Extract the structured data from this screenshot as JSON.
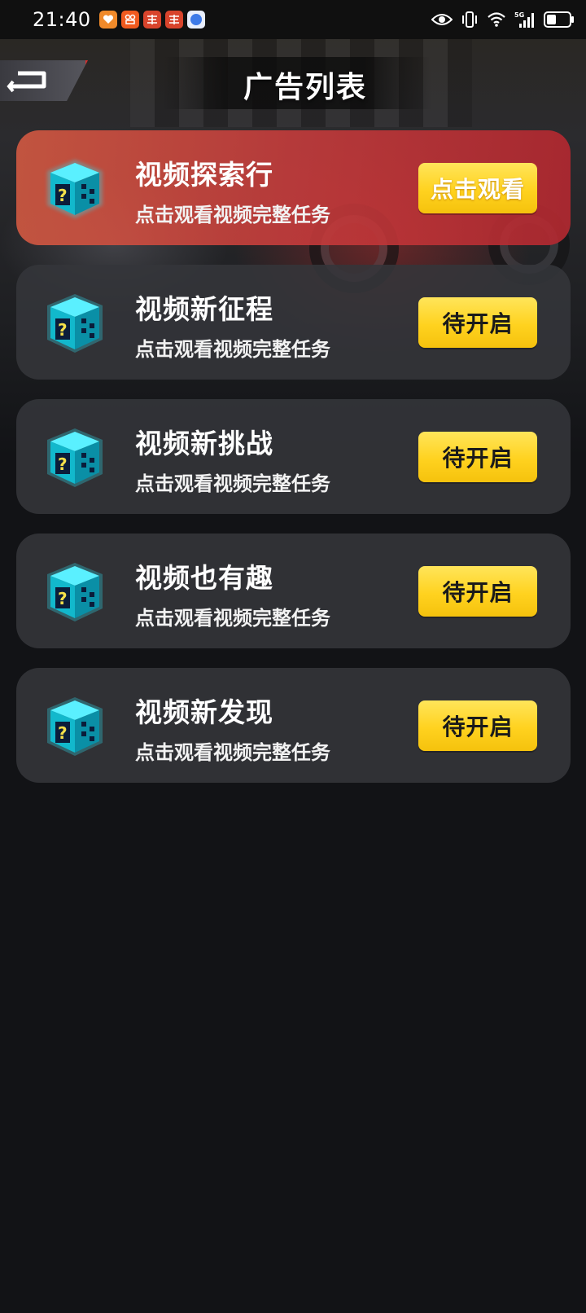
{
  "status_bar": {
    "time": "21:40",
    "notifications": [
      "heart-app-icon",
      "app-icon",
      "taobao-icon",
      "taobao-icon",
      "blue-dot-app-icon"
    ],
    "network": "5G"
  },
  "header": {
    "title": "广告列表",
    "back_icon": "back-arrow-icon"
  },
  "colors": {
    "background": "#121316",
    "card": "#34353a",
    "card_active": "#c83c3c",
    "button_yellow": "#ffd21f"
  },
  "ads": [
    {
      "title": "视频探索行",
      "subtitle": "点击观看视频完整任务",
      "button": "点击观看",
      "state": "active",
      "icon": "mystery-box-icon"
    },
    {
      "title": "视频新征程",
      "subtitle": "点击观看视频完整任务",
      "button": "待开启",
      "state": "pending",
      "icon": "mystery-box-icon"
    },
    {
      "title": "视频新挑战",
      "subtitle": "点击观看视频完整任务",
      "button": "待开启",
      "state": "pending",
      "icon": "mystery-box-icon"
    },
    {
      "title": "视频也有趣",
      "subtitle": "点击观看视频完整任务",
      "button": "待开启",
      "state": "pending",
      "icon": "mystery-box-icon"
    },
    {
      "title": "视频新发现",
      "subtitle": "点击观看视频完整任务",
      "button": "待开启",
      "state": "pending",
      "icon": "mystery-box-icon"
    }
  ]
}
